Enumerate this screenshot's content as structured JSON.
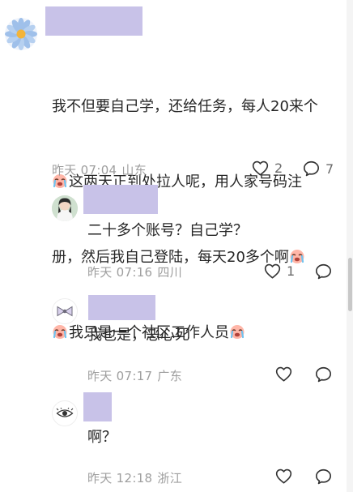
{
  "comments": [
    {
      "lines": [
        "我不但要自己学，还给任务，每人20来个",
        "这两天正到处拉人呢，用人家号码注",
        "册，然后我自己登陆，每天20多个啊",
        "我只是一个社区工作人员"
      ],
      "time": "昨天 07:04",
      "location": "山东",
      "like_count": "2",
      "reply_count": "7"
    },
    {
      "text": "二十多个账号？自己学？",
      "time": "昨天 07:16",
      "location": "四川",
      "like_count": "1"
    },
    {
      "text": "我也是，恶心死",
      "time": "昨天 07:17",
      "location": "广东"
    },
    {
      "text": "啊？",
      "time": "昨天 12:18",
      "location": "浙江"
    }
  ],
  "icons": {
    "like": "heart-outline-icon",
    "reply": "speech-bubble-icon",
    "emoji": "crying-face-emoji-icon"
  },
  "colors": {
    "redaction": "#c8c2e8",
    "meta_text": "#9e9e9e",
    "body_text": "#262626"
  }
}
